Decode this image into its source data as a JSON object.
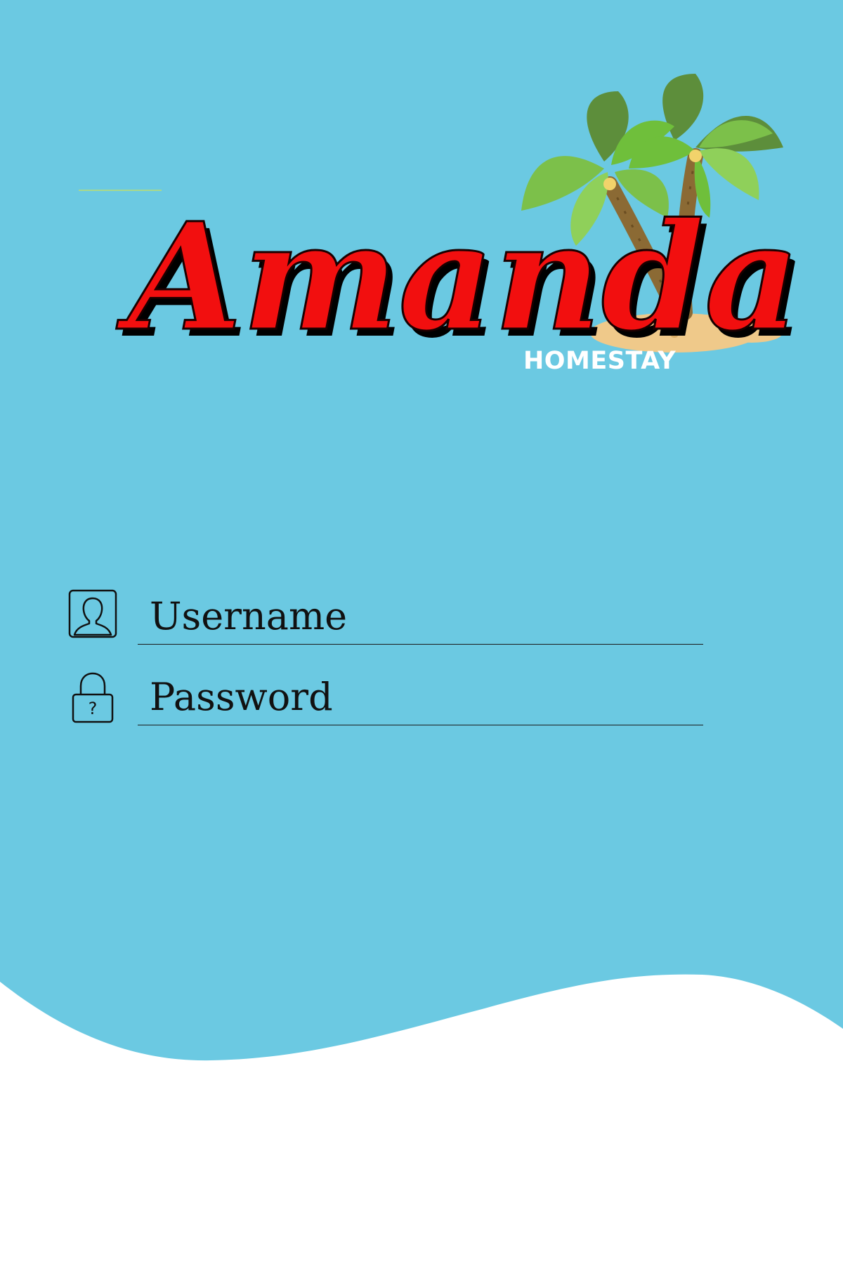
{
  "brand": {
    "name": "Amanda",
    "subtitle": "HOMESTAY"
  },
  "login": {
    "username": {
      "placeholder": "Username",
      "value": ""
    },
    "password": {
      "placeholder": "Password",
      "value": ""
    }
  },
  "icons": {
    "username": "user-silhouette-icon",
    "password": "padlock-question-icon"
  },
  "colors": {
    "background_blue": "#6bc9e2",
    "wave_white": "#ffffff",
    "brand_red": "#f20f0f",
    "brand_shadow": "#000000",
    "palm_leaf": "#6fbf3b",
    "palm_trunk": "#8b6a34",
    "sand": "#efc98a",
    "field_line": "#1a1a1a"
  }
}
